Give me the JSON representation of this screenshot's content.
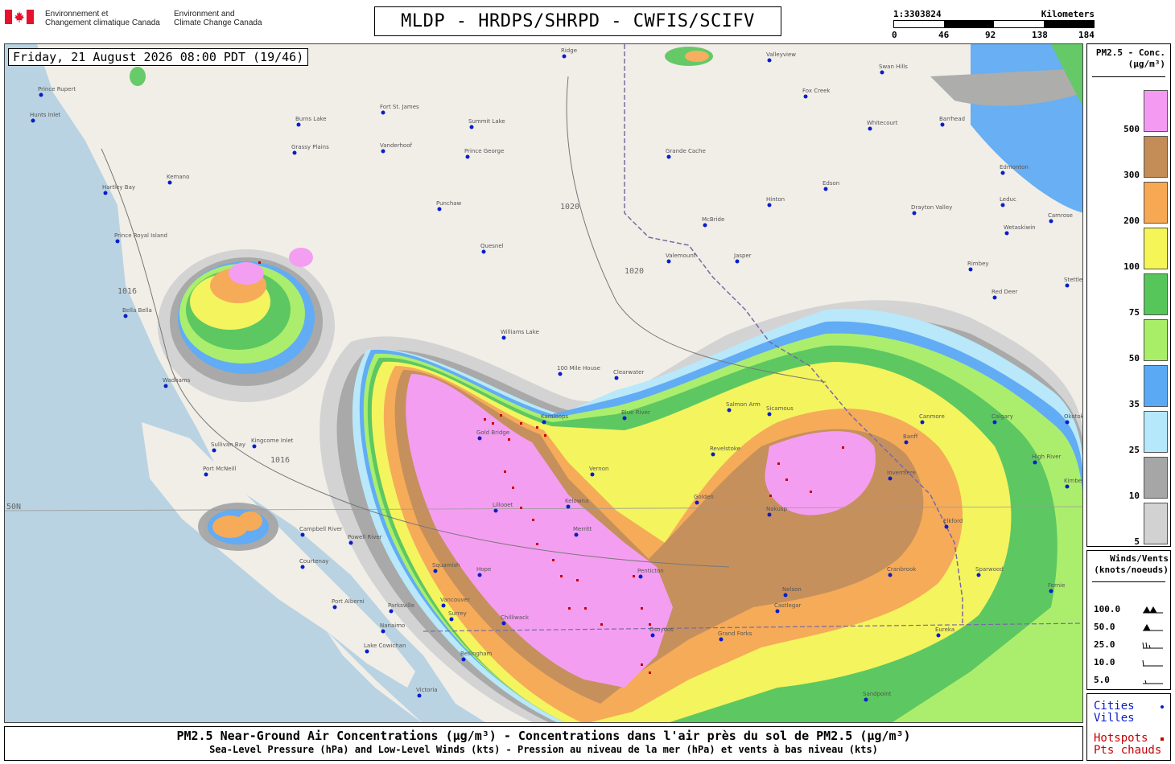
{
  "header": {
    "org_fr_line1": "Environnement et",
    "org_fr_line2": "Changement climatique Canada",
    "org_en_line1": "Environment and",
    "org_en_line2": "Climate Change Canada",
    "title": "MLDP - HRDPS/SHRPD - CWFIS/SCIFV"
  },
  "scale": {
    "ratio": "1:3303824",
    "unit": "Kilometers",
    "ticks": [
      "0",
      "46",
      "92",
      "138",
      "184"
    ]
  },
  "map": {
    "timestamp": "Friday, 21 August 2026 08:00 PDT (19/46)",
    "lat_label": "50N",
    "isobar_label": "1016",
    "isobar_label_2": "1020",
    "cities": [
      "Prince Rupert",
      "Hunts Inlet",
      "Burns Lake",
      "Fort St. James",
      "Summit Lake",
      "Vanderhoof",
      "Grassy Plains",
      "Prince George",
      "Kemano",
      "Hartley Bay",
      "Punchaw",
      "Prince Royal Island",
      "Quesnel",
      "Bella Bella",
      "Williams Lake",
      "Wadhams",
      "100 Mile House",
      "Clearwater",
      "Kingcome Inlet",
      "Sullivan Bay",
      "Port McNeill",
      "Campbell River",
      "Powell River",
      "Courtenay",
      "Squamish",
      "Port Alberni",
      "Parksville",
      "Nanaimo",
      "Vancouver",
      "Surrey",
      "Lake Cowichan",
      "Victoria",
      "Bellingham",
      "Kamloops",
      "Vernon",
      "Kelowna",
      "Penticton",
      "Osoyoos",
      "Revelstoke",
      "Nakusp",
      "Nelson",
      "Castlegar",
      "Cranbrook",
      "Invermere",
      "Golden",
      "Calgary",
      "Banff",
      "Canmore",
      "Jasper",
      "Hinton",
      "Valemount",
      "Grande Cache",
      "Whitecourt",
      "Edson",
      "Drayton Valley",
      "Edmonton",
      "Leduc",
      "Wetaskiwin",
      "Camrose",
      "Red Deer",
      "Rimbey",
      "Stettler",
      "Swan Hills",
      "Fox Creek",
      "Barrhead",
      "Valleyview",
      "Ridge",
      "Grand Forks",
      "Sandpoint",
      "Eureka",
      "Elkford",
      "Sparwood",
      "Gold Bridge",
      "Blue River",
      "McBride",
      "Lillooet",
      "Merritt",
      "Hope",
      "Chilliwack",
      "Salmon Arm",
      "Sicamous",
      "Okotoks",
      "High River",
      "Kimberley",
      "Fernie"
    ],
    "colors": {
      "land": "#f1eee8",
      "water": "#b9d3e2",
      "c5": "#d2d2d2",
      "c10": "#a6a6a6",
      "c25": "#b5e8fa",
      "c35": "#5aa9f5",
      "c50": "#a8ef67",
      "c75": "#56c65a",
      "c100": "#f5f558",
      "c200": "#f7a852",
      "c300": "#c48c56",
      "c500": "#f59af2",
      "city_dot": "#0a1ec8",
      "hotspot": "#c80000"
    }
  },
  "legend": {
    "title_line1": "PM2.5 - Conc.",
    "title_line2": "(µg/m³)",
    "items": [
      {
        "label": "500",
        "color": "#f59af2"
      },
      {
        "label": "300",
        "color": "#c48c56"
      },
      {
        "label": "200",
        "color": "#f7a852"
      },
      {
        "label": "100",
        "color": "#f5f558"
      },
      {
        "label": "75",
        "color": "#56c65a"
      },
      {
        "label": "50",
        "color": "#a8ef67"
      },
      {
        "label": "35",
        "color": "#5aa9f5"
      },
      {
        "label": "25",
        "color": "#b5e8fa"
      },
      {
        "label": "10",
        "color": "#a6a6a6"
      },
      {
        "label": "5",
        "color": "#d2d2d2"
      }
    ]
  },
  "winds": {
    "title_line1": "Winds/Vents",
    "title_line2": "(knots/noeuds)",
    "items": [
      "100.0",
      "50.0",
      "25.0",
      "10.0",
      "5.0"
    ]
  },
  "keys": {
    "cities": "Cities",
    "villes": "Villes",
    "hotspots": "Hotspots",
    "pts": "Pts chauds"
  },
  "caption": {
    "line1": "PM2.5 Near-Ground Air Concentrations (µg/m³) - Concentrations dans l'air près du sol de PM2.5 (µg/m³)",
    "line2": "Sea-Level Pressure (hPa) and Low-Level Winds (kts) - Pression au niveau de la mer (hPa) et vents à bas niveau (kts)"
  }
}
